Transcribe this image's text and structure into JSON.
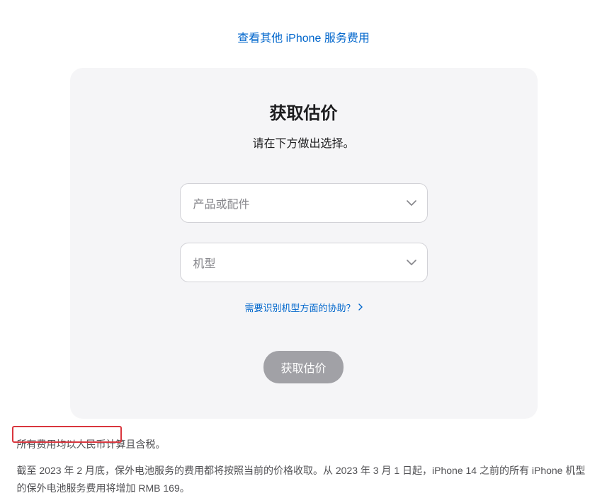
{
  "top_link": {
    "label": "查看其他 iPhone 服务费用"
  },
  "card": {
    "title": "获取估价",
    "subtitle": "请在下方做出选择。",
    "select_product_placeholder": "产品或配件",
    "select_model_placeholder": "机型",
    "help_link": "需要识别机型方面的协助？",
    "cta_label": "获取估价"
  },
  "footer": {
    "line1": "所有费用均以人民币计算且含税。",
    "line2": "截至 2023 年 2 月底，保外电池服务的费用都将按照当前的价格收取。从 2023 年 3 月 1 日起，iPhone 14 之前的所有 iPhone 机型的保外电池服务费用将增加 RMB 169。"
  }
}
